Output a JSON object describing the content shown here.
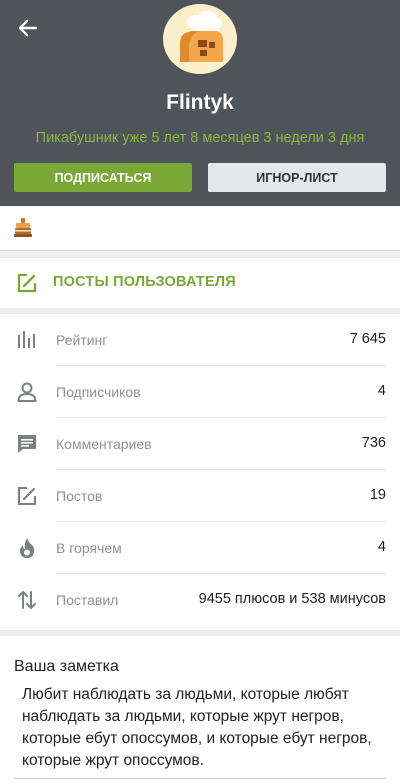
{
  "profile": {
    "username": "Flintyk",
    "since": "Пикабушник уже 5 лет 8 месяцев 3 недели 3 дня",
    "subscribe_label": "ПОДПИСАТЬСЯ",
    "ignore_label": "ИГНОР-ЛИСТ"
  },
  "posts_link": {
    "label": "ПОСТЫ ПОЛЬЗОВАТЕЛЯ"
  },
  "stats": [
    {
      "icon": "rating-icon",
      "label": "Рейтинг",
      "value": "7 645"
    },
    {
      "icon": "user-icon",
      "label": "Подписчиков",
      "value": "4"
    },
    {
      "icon": "comment-icon",
      "label": "Комментариев",
      "value": "736"
    },
    {
      "icon": "edit-icon",
      "label": "Постов",
      "value": "19"
    },
    {
      "icon": "fire-icon",
      "label": "В горячем",
      "value": "4"
    },
    {
      "icon": "sort-icon",
      "label": "Поставил",
      "value": "9455 плюсов и 538 минусов"
    }
  ],
  "note": {
    "title": "Ваша заметка",
    "text": "Любит наблюдать за людьми, которые любят наблюдать за людьми, которые жрут негров, которые ебут опоссумов, и которые ебут негров, которые жрут опоссумов."
  },
  "colors": {
    "header": "#4e545a",
    "accent": "#7aa836",
    "since": "#8ab83f"
  }
}
